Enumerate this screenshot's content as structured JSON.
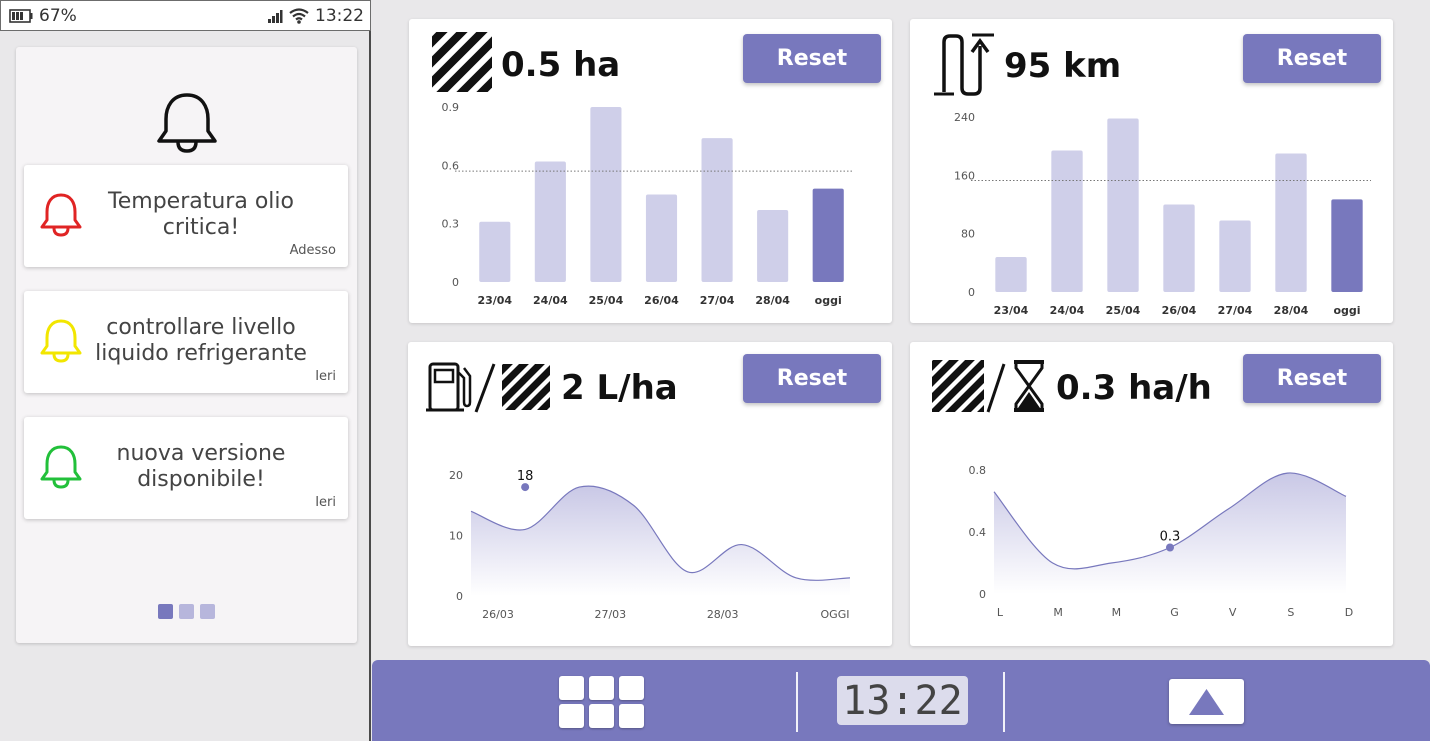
{
  "status_bar": {
    "battery": "67%",
    "time": "13:22"
  },
  "notifications_panel": {
    "items": [
      {
        "message": "Temperatura olio critica!",
        "time": "Adesso",
        "color": "#e02424"
      },
      {
        "message": "controllare livello liquido refrigerante",
        "time": "Ieri",
        "color": "#f2e600"
      },
      {
        "message": "nuova versione disponibile!",
        "time": "Ieri",
        "color": "#22c03a"
      }
    ],
    "page_count": 3,
    "active_page": 0
  },
  "cards": {
    "area": {
      "value": "0.5 ha",
      "reset_label": "Reset",
      "icon": "hatched-area-icon"
    },
    "distance": {
      "value": "95 km",
      "reset_label": "Reset",
      "icon": "route-distance-icon"
    },
    "fuel": {
      "value": "2 L/ha",
      "reset_label": "Reset",
      "icon": "fuel-pump-per-area-icon"
    },
    "rate": {
      "value": "0.3 ha/h",
      "reset_label": "Reset",
      "icon": "area-per-hour-icon"
    }
  },
  "chart_data": [
    {
      "type": "bar",
      "categories": [
        "23/04",
        "24/04",
        "25/04",
        "26/04",
        "27/04",
        "28/04",
        "oggi"
      ],
      "values": [
        0.31,
        0.62,
        0.9,
        0.45,
        0.74,
        0.37,
        0.48
      ],
      "yticks": [
        0,
        0.3,
        0.6,
        0.9
      ],
      "ylim": [
        0,
        0.9
      ],
      "average_line": 0.57,
      "highlight": "oggi",
      "colors": {
        "bar": "#cfcfe9",
        "highlight": "#7878bd"
      }
    },
    {
      "type": "bar",
      "categories": [
        "23/04",
        "24/04",
        "25/04",
        "26/04",
        "27/04",
        "28/04",
        "oggi"
      ],
      "values": [
        48,
        194,
        238,
        120,
        98,
        190,
        127
      ],
      "yticks": [
        0,
        80,
        160,
        240
      ],
      "ylim": [
        0,
        240
      ],
      "average_line": 153,
      "highlight": "oggi",
      "colors": {
        "bar": "#cfcfe9",
        "highlight": "#7878bd"
      }
    },
    {
      "type": "area",
      "categories": [
        "26/03",
        "27/03",
        "28/03",
        "OGGI"
      ],
      "x": [
        0,
        0.5,
        1,
        1.5,
        2,
        2.5,
        3,
        3.5
      ],
      "values": [
        14,
        11,
        18,
        15,
        4,
        8.5,
        3,
        3
      ],
      "yticks": [
        0,
        10,
        20
      ],
      "ylim": [
        0,
        20
      ],
      "annotation": {
        "label": "18",
        "x": 0.5,
        "value": 18
      }
    },
    {
      "type": "area",
      "categories": [
        "L",
        "M",
        "M",
        "G",
        "V",
        "S",
        "D"
      ],
      "values": [
        0.66,
        0.2,
        0.2,
        0.3,
        0.55,
        0.78,
        0.63
      ],
      "yticks": [
        0,
        0.4,
        0.8
      ],
      "ylim": [
        0,
        0.8
      ],
      "annotation": {
        "label": "0.3",
        "x": 3,
        "value": 0.3
      }
    }
  ],
  "bottom_bar": {
    "clock": "13:22"
  }
}
